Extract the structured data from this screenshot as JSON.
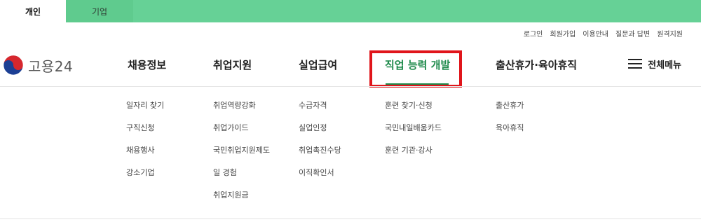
{
  "top_tabs": [
    {
      "label": "개인"
    },
    {
      "label": "기업"
    }
  ],
  "utility_links": [
    "로그인",
    "회원가입",
    "이용안내",
    "질문과 답변",
    "원격지원"
  ],
  "logo": {
    "text": "고용24",
    "icon": "taegeuk-emblem-icon"
  },
  "gnb": [
    {
      "label": "채용정보"
    },
    {
      "label": "취업지원"
    },
    {
      "label": "실업급여"
    },
    {
      "label": "직업 능력 개발"
    },
    {
      "label": "출산휴가·육아휴직"
    }
  ],
  "all_menu": {
    "label": "전체메뉴",
    "icon": "hamburger-icon"
  },
  "submenus": [
    [
      "일자리 찾기",
      "구직신청",
      "채용행사",
      "강소기업"
    ],
    [
      "취업역량강화",
      "취업가이드",
      "국민취업지원제도",
      "일 경험",
      "취업지원금"
    ],
    [
      "수급자격",
      "실업인정",
      "취업촉진수당",
      "이직확인서"
    ],
    [
      "훈련 찾기·신청",
      "국민내일배움카드",
      "훈련 기관·강사"
    ],
    [
      "출산휴가",
      "육아휴직"
    ]
  ],
  "colors": {
    "topbar": "#66d196",
    "active": "#1e8a4b",
    "highlight": "#e0151b"
  }
}
